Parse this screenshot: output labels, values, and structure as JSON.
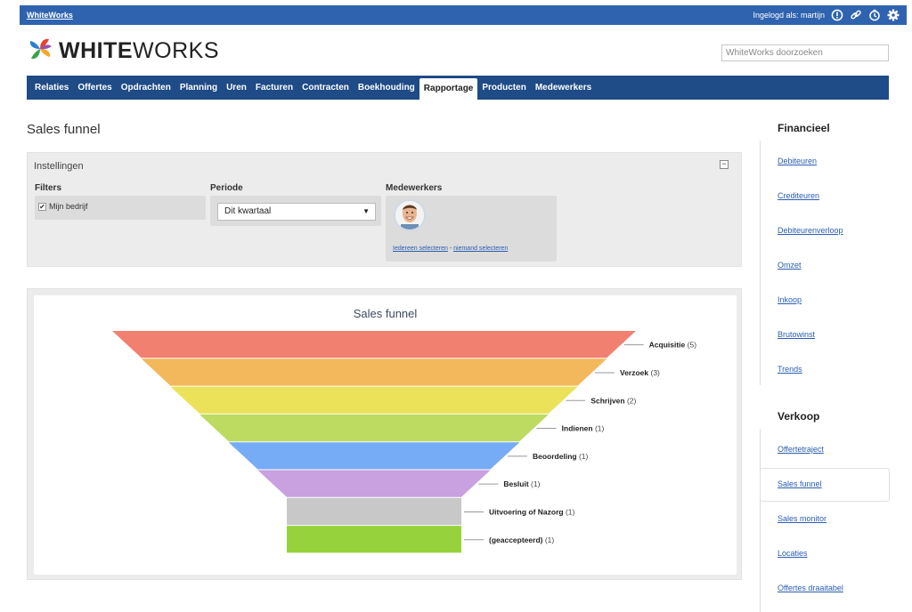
{
  "topbar": {
    "brand_link": "WhiteWorks",
    "logged_in": "Ingelogd als: martijn",
    "icons": [
      "info-icon",
      "link-icon",
      "clock-icon",
      "gear-icon"
    ]
  },
  "logo": {
    "bold": "WHITE",
    "light": "WORKS"
  },
  "search": {
    "placeholder": "WhiteWorks doorzoeken"
  },
  "nav": {
    "items": [
      "Relaties",
      "Offertes",
      "Opdrachten",
      "Planning",
      "Uren",
      "Facturen",
      "Contracten",
      "Boekhouding",
      "Rapportage",
      "Producten",
      "Medewerkers"
    ],
    "active": "Rapportage"
  },
  "page_title": "Sales funnel",
  "settings": {
    "title": "Instellingen",
    "collapse": "−",
    "filters_label": "Filters",
    "filter_item": "Mijn bedrijf",
    "filter_checked": true,
    "period_label": "Periode",
    "period_value": "Dit kwartaal",
    "employees_label": "Medewerkers",
    "select_all": "Iedereen selecteren",
    "separator": " - ",
    "select_none": "niemand selecteren"
  },
  "chart_data": {
    "type": "funnel",
    "title": "Sales funnel",
    "stages": [
      {
        "label": "Acquisitie",
        "count": 5,
        "color": "#f28070"
      },
      {
        "label": "Verzoek",
        "count": 3,
        "color": "#f4b85c"
      },
      {
        "label": "Schrijven",
        "count": 2,
        "color": "#ece25a"
      },
      {
        "label": "Indienen",
        "count": 1,
        "color": "#bddb60"
      },
      {
        "label": "Beoordeling",
        "count": 1,
        "color": "#76abf5"
      },
      {
        "label": "Besluit",
        "count": 1,
        "color": "#c9a0e0"
      },
      {
        "label": "Uitvoering of Nazorg",
        "count": 1,
        "color": "#c8c8c8"
      },
      {
        "label": "(geaccepteerd)",
        "count": 1,
        "color": "#96d23c"
      }
    ]
  },
  "sidebar": {
    "financial_heading": "Financieel",
    "financial_links": [
      "Debiteuren",
      "Crediteuren",
      "Debiteurenverloop",
      "Omzet",
      "Inkoop",
      "Brutowinst",
      "Trends"
    ],
    "sales_heading": "Verkoop",
    "sales_links": [
      "Offertetraject",
      "Sales funnel",
      "Sales monitor",
      "Locaties",
      "Offertes draaitabel"
    ],
    "active_link": "Sales funnel"
  },
  "colors": {
    "topbar": "#2f63b0",
    "navbar": "#1f4b86",
    "link": "#2a5db0"
  }
}
